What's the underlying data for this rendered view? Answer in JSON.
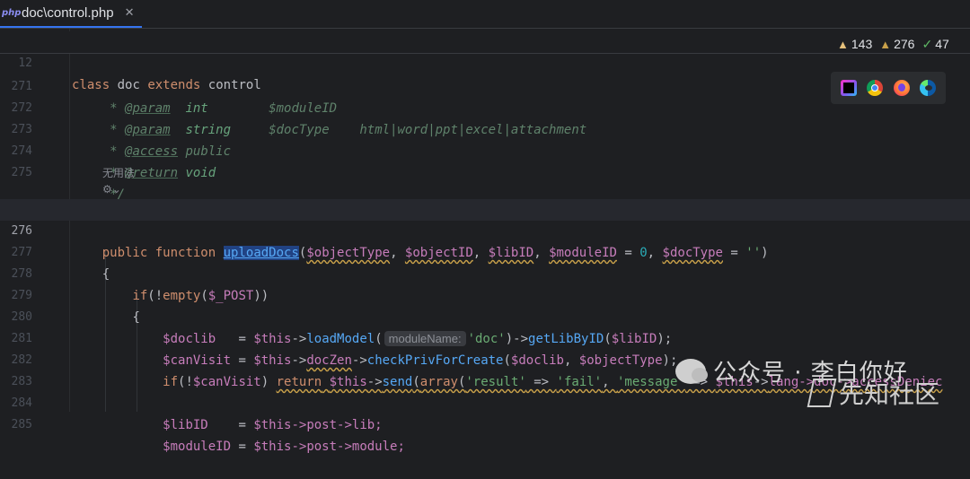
{
  "tab": {
    "icon_label": "php",
    "title": "doc\\control.php",
    "close": "✕"
  },
  "inspections": {
    "errors": "143",
    "warnings": "276",
    "ok": "47"
  },
  "sticky": {
    "line_number": "12",
    "kw_class": "class",
    "name": "doc",
    "kw_extends": "extends",
    "parent": "control"
  },
  "lines": {
    "l271": {
      "n": "271",
      "star": "* ",
      "tag": "@param",
      "type": "int",
      "var": "$moduleID"
    },
    "l272": {
      "n": "272",
      "star": "* ",
      "tag": "@param",
      "type": "string",
      "var": "$docType",
      "desc": "html|word|ppt|excel|attachment"
    },
    "l273": {
      "n": "273",
      "star": "* ",
      "tag": "@access",
      "type": "public"
    },
    "l274": {
      "n": "274",
      "star": "* ",
      "tag": "@return",
      "type": "void"
    },
    "l275": {
      "n": "275",
      "end": "*/"
    },
    "inlay_usage": "无用法",
    "inlay_icon": "⚙⌄",
    "l276": {
      "n": "276",
      "kw_public": "public",
      "kw_function": "function",
      "fn": "uploadDocs",
      "p1": "$objectType",
      "p2": "$objectID",
      "p3": "$libID",
      "p4": "$moduleID",
      "zero": "0",
      "p5": "$docType",
      "empty_str": "''"
    },
    "l277": {
      "n": "277",
      "text": "{"
    },
    "l278": {
      "n": "278",
      "kw_if": "if",
      "rest_a": "(!",
      "empty": "empty",
      "open": "(",
      "post": "$_POST",
      "close": "))"
    },
    "l279": {
      "n": "279",
      "text": "{"
    },
    "l280": {
      "n": "280",
      "v1": "$doclib",
      "eq": "   = ",
      "this": "$this",
      "arrow": "->",
      "m1": "loadModel",
      "hint": "moduleName:",
      "s1": "'doc'",
      "m2": "getLibByID",
      "v2": "$libID",
      "end": ");"
    },
    "l281": {
      "n": "281",
      "v1": "$canVisit",
      "eq": " = ",
      "this": "$this",
      "arrow": "->",
      "p": "docZen",
      "m": "checkPrivForCreate",
      "a1": "$doclib",
      "a2": "$objectType",
      "end": ");"
    },
    "l282": {
      "n": "282",
      "kw_if": "if",
      "v": "$canVisit",
      "kw_return": "return",
      "this": "$this",
      "m": "send",
      "arr": "array",
      "k1": "'result'",
      "v1": "'fail'",
      "k2": "'message'",
      "this2": "$this",
      "chain": "lang->doc->accessDeniec"
    },
    "l283": {
      "n": "283"
    },
    "l284": {
      "n": "284",
      "v": "$libID",
      "eq": "    = ",
      "this": "$this",
      "rest": "->post->lib;"
    },
    "l285": {
      "n": "285",
      "v": "$moduleID",
      "eq": " = ",
      "this": "$this",
      "rest": "->post->module;"
    }
  },
  "watermark": {
    "wechat": "公众号 · 李白你好",
    "xz": "先知社区"
  }
}
